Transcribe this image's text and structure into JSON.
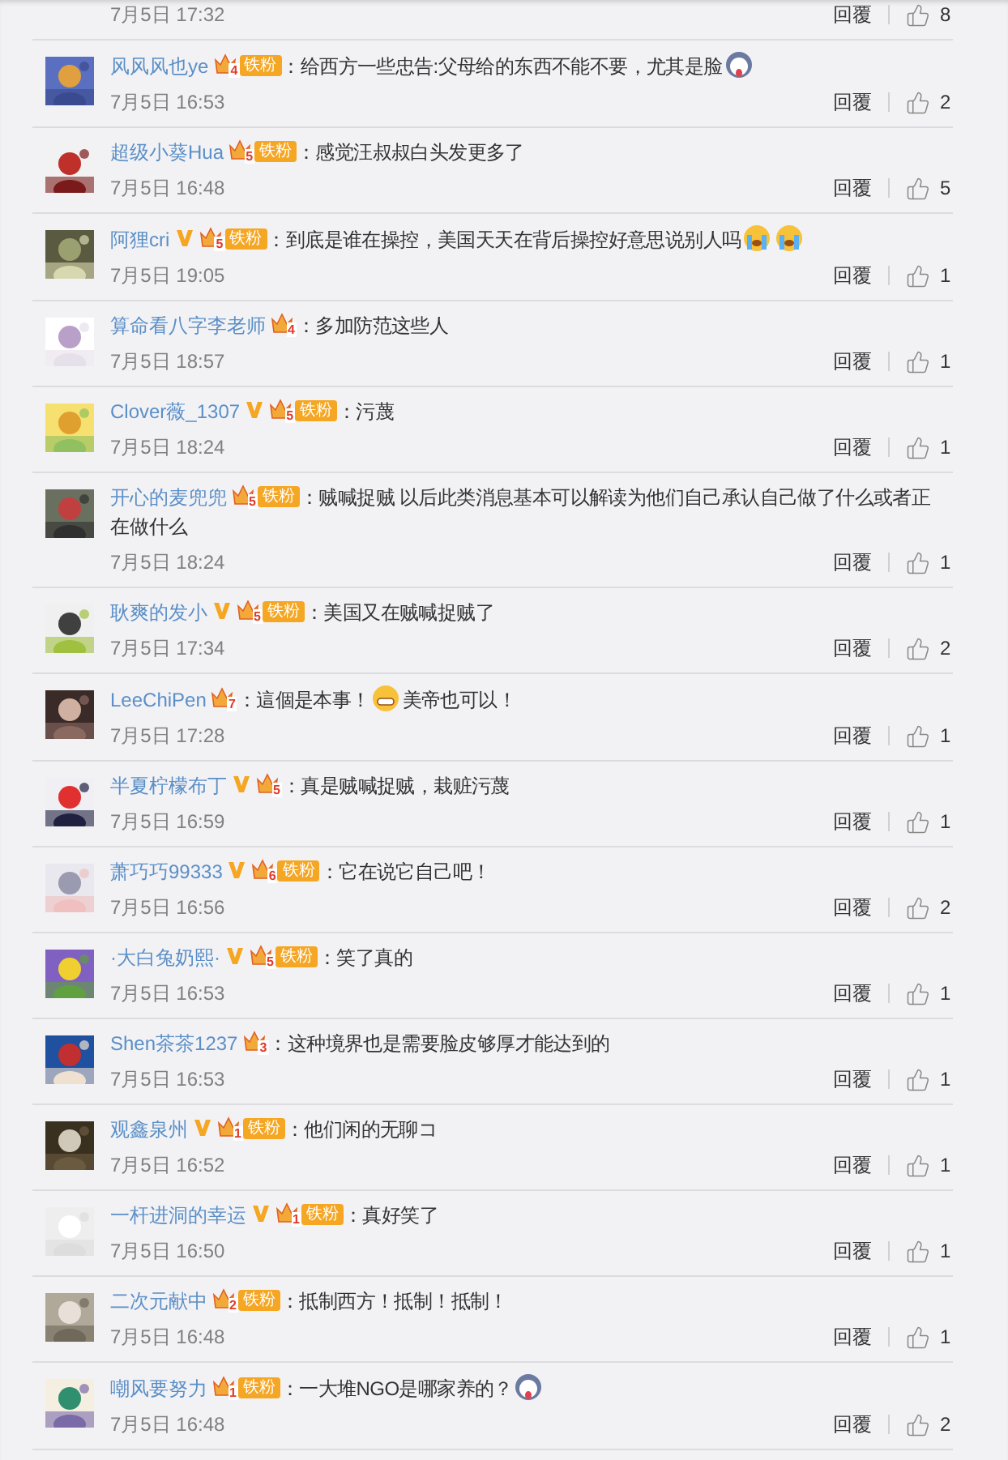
{
  "comments": [
    {
      "date": "7月5日 17:32",
      "reply": "回覆",
      "likes": "8"
    },
    {
      "user": "风风风也ye",
      "verified": false,
      "badge": {
        "level": "4",
        "label": "铁粉"
      },
      "content": [
        {
          "kind": "text",
          "text": "：给西方一些忠告:父母给的东西不能不要，尤其是脸"
        },
        {
          "kind": "husky"
        }
      ],
      "date": "7月5日 16:53",
      "reply": "回覆",
      "likes": "2"
    },
    {
      "user": "超级小葵Hua",
      "verified": false,
      "badge": {
        "level": "5",
        "label": "铁粉"
      },
      "content": [
        {
          "kind": "text",
          "text": "：感觉汪叔叔白头发更多了"
        }
      ],
      "date": "7月5日 16:48",
      "reply": "回覆",
      "likes": "5"
    },
    {
      "user": "阿狸cri",
      "verified": true,
      "badge": {
        "level": "5",
        "label": "铁粉"
      },
      "content": [
        {
          "kind": "text",
          "text": "：到底是谁在操控，美国天天在背后操控好意思说别人吗"
        },
        {
          "kind": "tears"
        },
        {
          "kind": "tears"
        }
      ],
      "date": "7月5日 19:05",
      "reply": "回覆",
      "likes": "1"
    },
    {
      "user": "算命看八字李老师",
      "verified": false,
      "badge": {
        "level": "4"
      },
      "content": [
        {
          "kind": "text",
          "text": "：多加防范这些人"
        }
      ],
      "date": "7月5日 18:57",
      "reply": "回覆",
      "likes": "1"
    },
    {
      "user": "Clover薇_1307",
      "verified": true,
      "badge": {
        "level": "5",
        "label": "铁粉"
      },
      "content": [
        {
          "kind": "text",
          "text": "：污蔑"
        }
      ],
      "date": "7月5日 18:24",
      "reply": "回覆",
      "likes": "1"
    },
    {
      "user": "开心的麦兜兜",
      "verified": false,
      "badge": {
        "level": "5",
        "label": "铁粉"
      },
      "content": [
        {
          "kind": "text",
          "text": "：贼喊捉贼 以后此类消息基本可以解读为他们自己承认自己做了什么或者正"
        },
        {
          "kind": "next_line",
          "text": "在做什么"
        }
      ],
      "date": "7月5日 18:24",
      "reply": "回覆",
      "likes": "1"
    },
    {
      "user": "耿爽的发小",
      "verified": true,
      "badge": {
        "level": "5",
        "label": "铁粉"
      },
      "content": [
        {
          "kind": "text",
          "text": "：美国又在贼喊捉贼了"
        }
      ],
      "date": "7月5日 17:34",
      "reply": "回覆",
      "likes": "2"
    },
    {
      "user": "LeeChiPen",
      "verified": false,
      "badge": {
        "level": "7"
      },
      "content": [
        {
          "kind": "text",
          "text": "：這個是本事！"
        },
        {
          "kind": "grin"
        },
        {
          "kind": "text",
          "text": "美帝也可以！"
        }
      ],
      "date": "7月5日 17:28",
      "reply": "回覆",
      "likes": "1"
    },
    {
      "user": "半夏柠檬布丁",
      "verified": true,
      "badge": {
        "level": "5"
      },
      "content": [
        {
          "kind": "text",
          "text": "：真是贼喊捉贼，栽赃污蔑"
        }
      ],
      "date": "7月5日 16:59",
      "reply": "回覆",
      "likes": "1"
    },
    {
      "user": "萧巧巧99333",
      "verified": true,
      "badge": {
        "level": "6",
        "label": "铁粉"
      },
      "content": [
        {
          "kind": "text",
          "text": "：它在说它自己吧！"
        }
      ],
      "date": "7月5日 16:56",
      "reply": "回覆",
      "likes": "2"
    },
    {
      "user": "·大白兔奶熙·",
      "verified": true,
      "badge": {
        "level": "5",
        "label": "铁粉"
      },
      "content": [
        {
          "kind": "text",
          "text": "：笑了真的"
        }
      ],
      "date": "7月5日 16:53",
      "reply": "回覆",
      "likes": "1"
    },
    {
      "user": "Shen茶茶1237",
      "verified": false,
      "badge": {
        "level": "3"
      },
      "content": [
        {
          "kind": "text",
          "text": "：这种境界也是需要脸皮够厚才能达到的"
        }
      ],
      "date": "7月5日 16:53",
      "reply": "回覆",
      "likes": "1"
    },
    {
      "user": "观鑫泉州",
      "verified": true,
      "badge": {
        "level": "1",
        "label": "铁粉"
      },
      "content": [
        {
          "kind": "text",
          "text": "：他们闲的无聊コ"
        }
      ],
      "date": "7月5日 16:52",
      "reply": "回覆",
      "likes": "1"
    },
    {
      "user": "一杆进洞的幸运",
      "verified": true,
      "badge": {
        "level": "1",
        "label": "铁粉"
      },
      "content": [
        {
          "kind": "text",
          "text": "：真好笑了"
        }
      ],
      "date": "7月5日 16:50",
      "reply": "回覆",
      "likes": "1"
    },
    {
      "user": "二次元献中",
      "verified": false,
      "badge": {
        "level": "2",
        "label": "铁粉"
      },
      "content": [
        {
          "kind": "text",
          "text": "：抵制西方！抵制！抵制！"
        }
      ],
      "date": "7月5日 16:48",
      "reply": "回覆",
      "likes": "1"
    },
    {
      "user": "嘲风要努力",
      "verified": false,
      "badge": {
        "level": "1",
        "label": "铁粉"
      },
      "content": [
        {
          "kind": "text",
          "text": "：一大堆NGO是哪家养的？"
        },
        {
          "kind": "husky"
        }
      ],
      "date": "7月5日 16:48",
      "reply": "回覆",
      "likes": "2"
    }
  ]
}
